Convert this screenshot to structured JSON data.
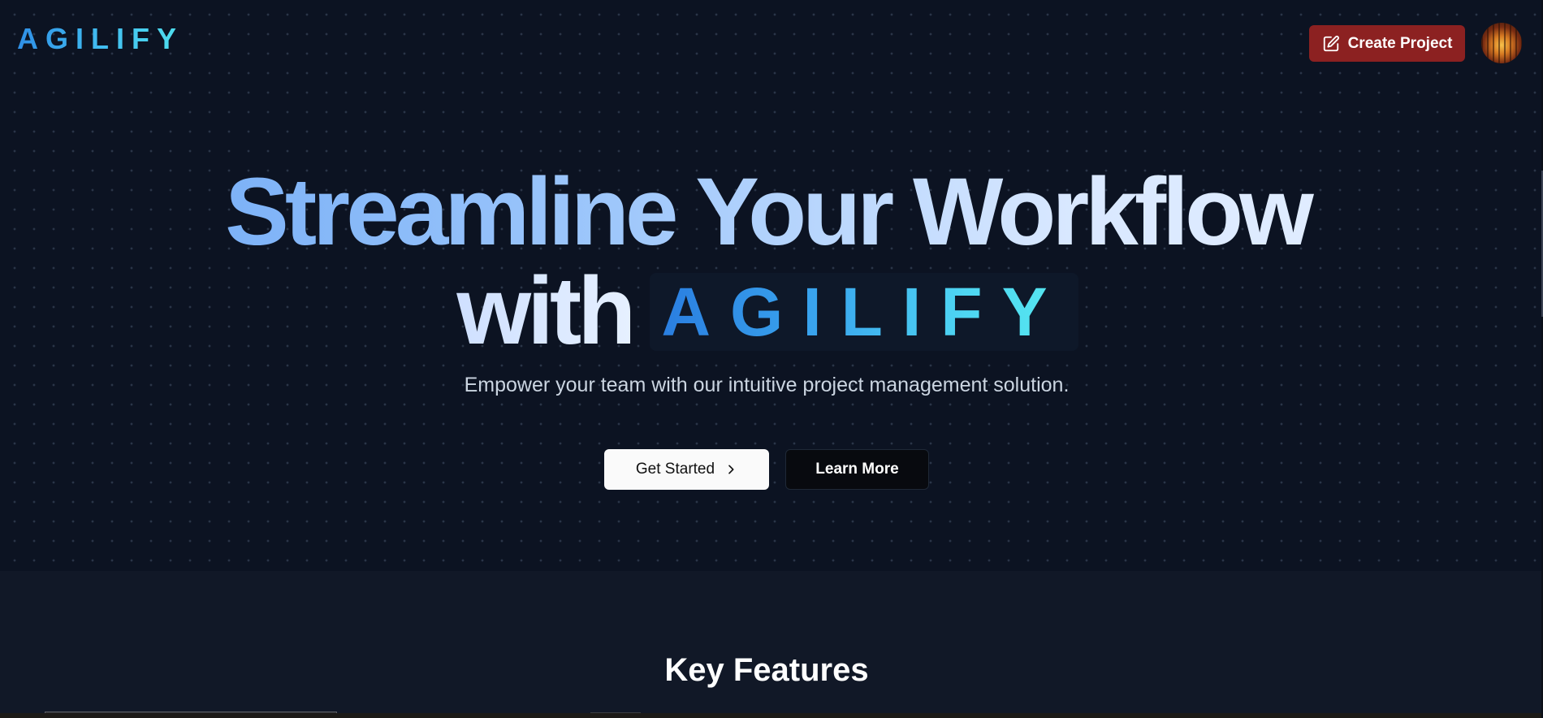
{
  "header": {
    "logo_text": "AGILIFY",
    "create_project_label": "Create Project",
    "create_icon": "edit-square-icon",
    "avatar_icon": "user-avatar"
  },
  "hero": {
    "headline_line1": "Streamline Your Workflow",
    "headline_with": "with",
    "headline_brand": "AGILIFY",
    "subtitle": "Empower your team with our intuitive project management solution.",
    "primary_button": "Get Started",
    "primary_button_icon": "chevron-right-icon",
    "secondary_button": "Learn More"
  },
  "features": {
    "title": "Key Features"
  },
  "colors": {
    "background": "#0c1322",
    "features_background": "#111827",
    "accent_red": "#8c2121",
    "brand_blue": "#2f8fe6",
    "brand_cyan": "#4fe0ee"
  }
}
